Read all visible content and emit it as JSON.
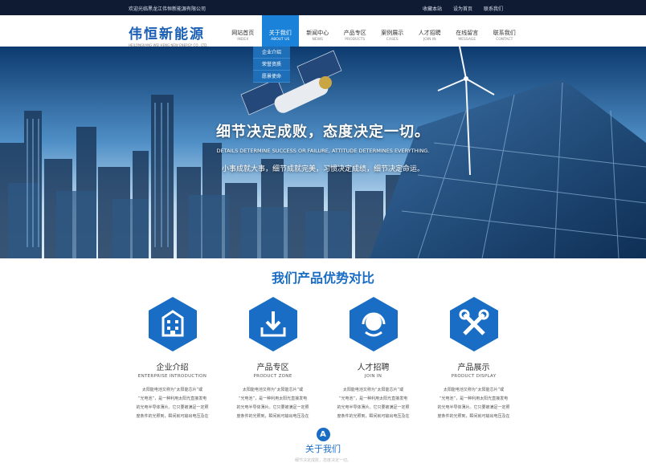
{
  "topbar": {
    "welcome": "欢迎光临黑龙江伟恒新能源有限公司",
    "links": [
      "收藏本站",
      "设为首页",
      "联系我们"
    ]
  },
  "logo": {
    "cn": "伟恒新能源",
    "en": "HEILONGJIANG WEI HENG NEW ENERGY CO., LTD."
  },
  "nav": [
    {
      "zh": "网站首页",
      "en": "INDEX"
    },
    {
      "zh": "关于我们",
      "en": "ABOUT US"
    },
    {
      "zh": "新闻中心",
      "en": "NEWS"
    },
    {
      "zh": "产品专区",
      "en": "PRODUCTS"
    },
    {
      "zh": "案例展示",
      "en": "CASES"
    },
    {
      "zh": "人才招聘",
      "en": "JOIN IN"
    },
    {
      "zh": "在线留言",
      "en": "MESSAGE"
    },
    {
      "zh": "联系我们",
      "en": "CONTACT"
    }
  ],
  "dropdown": [
    "企业介绍",
    "荣誉资质",
    "愿景使命"
  ],
  "banner": {
    "slogan_cn": "细节决定成败，态度决定一切。",
    "slogan_en": "DETAILS DETERMINE SUCCESS OR FAILURE, ATTITUDE DETERMINES EVERYTHING.",
    "slogan_sub": "小事成就大事，细节成就完美，习惯决定成绩，细节决定命运。"
  },
  "section": {
    "title": "我们产品优势对比"
  },
  "cards": [
    {
      "cn": "企业介绍",
      "en": "ENTERPRISE INTRODUCTION",
      "icon": "building-icon",
      "desc": [
        "太阳能电池又称为“太阳能芯片”或",
        "“光电池”，是一种利用太阳光直接发电",
        "的光电半导体薄片。它只要被满足一定照",
        "度条件的光照到，瞬间就可输出电压及在"
      ]
    },
    {
      "cn": "产品专区",
      "en": "PRODUCT ZONE",
      "icon": "download-icon",
      "desc": [
        "太阳能电池又称为“太阳能芯片”或",
        "“光电池”，是一种利用太阳光直接发电",
        "的光电半导体薄片。它只要被满足一定照",
        "度条件的光照到，瞬间就可输出电压及在"
      ]
    },
    {
      "cn": "人才招聘",
      "en": "JOIN IN",
      "icon": "headset-icon",
      "desc": [
        "太阳能电池又称为“太阳能芯片”或",
        "“光电池”，是一种利用太阳光直接发电",
        "的光电半导体薄片。它只要被满足一定照",
        "度条件的光照到，瞬间就可输出电压及在"
      ]
    },
    {
      "cn": "产品展示",
      "en": "PRODUCT DISPLAY",
      "icon": "tools-icon",
      "desc": [
        "太阳能电池又称为“太阳能芯片”或",
        "“光电池”，是一种利用太阳光直接发电",
        "的光电半导体薄片。它只要被满足一定照",
        "度条件的光照到，瞬间就可输出电压及在"
      ]
    }
  ],
  "about": {
    "badge": "A",
    "title": "关于我们",
    "sub": "细节决定成败，态度决定一切。"
  },
  "colors": {
    "primary": "#1a6dc4",
    "nav_active": "#1a82d8",
    "topbar_bg": "#0f1a33"
  }
}
